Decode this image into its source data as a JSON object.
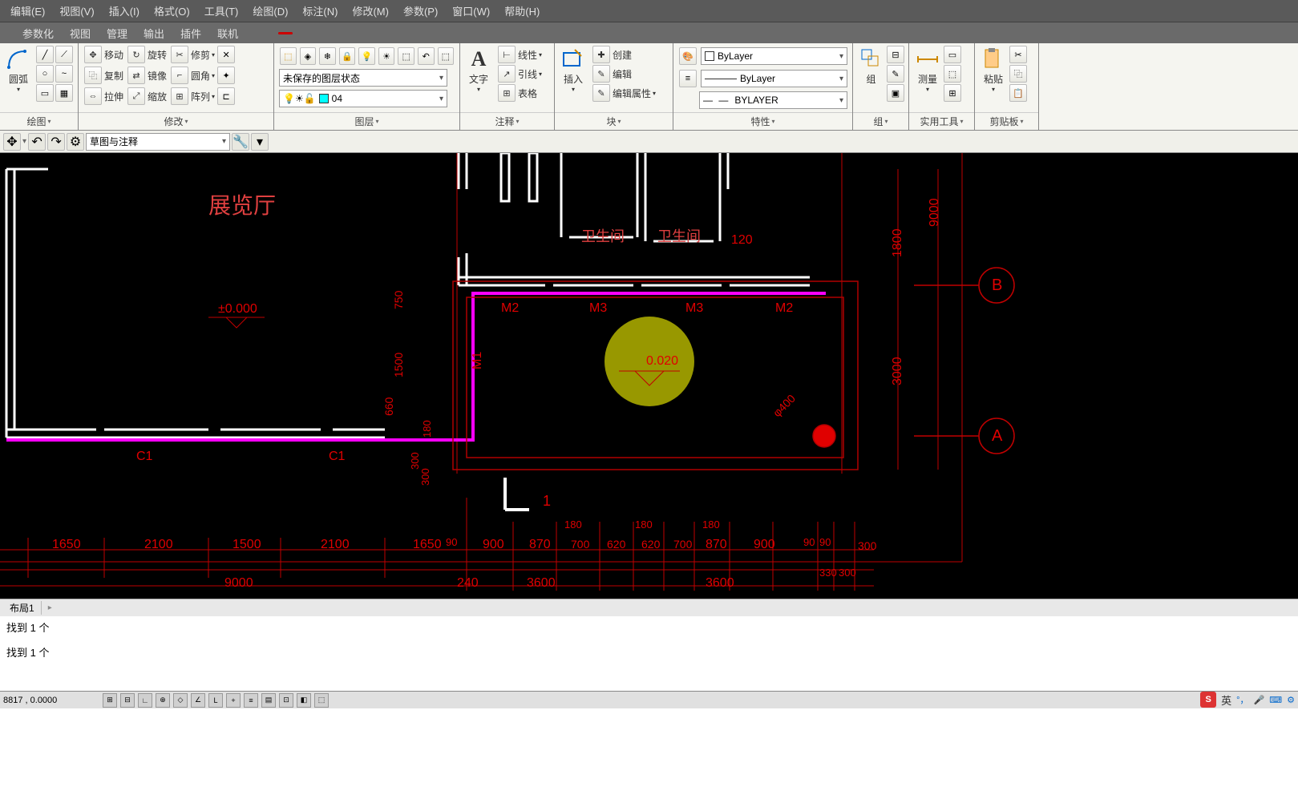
{
  "menu": {
    "items": [
      "编辑(E)",
      "视图(V)",
      "插入(I)",
      "格式(O)",
      "工具(T)",
      "绘图(D)",
      "标注(N)",
      "修改(M)",
      "参数(P)",
      "窗口(W)",
      "帮助(H)"
    ],
    "row2": [
      "参数化",
      "视图",
      "管理",
      "输出",
      "插件",
      "联机"
    ]
  },
  "ribbon": {
    "draw": {
      "arc": "圆弧",
      "title": "绘图"
    },
    "modify": {
      "move": "移动",
      "rotate": "旋转",
      "trim": "修剪",
      "copy": "复制",
      "mirror": "镜像",
      "fillet": "圆角",
      "stretch": "拉伸",
      "scale": "缩放",
      "array": "阵列",
      "title": "修改"
    },
    "layer": {
      "state": "未保存的图层状态",
      "current": "04",
      "title": "图层"
    },
    "annot": {
      "text": "文字",
      "linear": "线性",
      "leader": "引线",
      "table": "表格",
      "title": "注释"
    },
    "block": {
      "insert": "插入",
      "create": "创建",
      "edit": "编辑",
      "attr": "编辑属性",
      "title": "块"
    },
    "props": {
      "color": "ByLayer",
      "ltype": "ByLayer",
      "lweight": "BYLAYER",
      "title": "特性"
    },
    "group": {
      "group": "组",
      "title": "组"
    },
    "util": {
      "measure": "测量",
      "title": "实用工具"
    },
    "clip": {
      "paste": "粘贴",
      "title": "剪贴板"
    }
  },
  "qat": {
    "workspace": "草图与注释"
  },
  "cad": {
    "rooms": {
      "exhibit": "展览厅",
      "toilet1": "卫生间",
      "toilet2": "卫生间"
    },
    "elev1": "±0.000",
    "elev2": "0.020",
    "doors": {
      "m1": "M1",
      "m2": "M2",
      "m3": "M3"
    },
    "cols": {
      "c1": "C1"
    },
    "axes": {
      "a": "A",
      "b": "B"
    },
    "dims": {
      "d9000": "9000",
      "d1800": "1800",
      "d3000": "3000",
      "d750": "750",
      "d1500": "1500",
      "d660": "660",
      "d180": "180",
      "d300": "300",
      "d120": "120",
      "d240": "240",
      "d3600": "3600",
      "d330": "330",
      "d1650": "1650",
      "d2100": "2100",
      "d900": "900",
      "d870": "870",
      "d700": "700",
      "d620": "620",
      "d90": "90",
      "phi400": "φ400"
    }
  },
  "tabs": {
    "layout1": "布局1"
  },
  "cmd": {
    "line1": "找到 1 个",
    "line2": "找到 1 个"
  },
  "status": {
    "coords": "8817 , 0.0000"
  },
  "ime": {
    "lang": "英"
  }
}
